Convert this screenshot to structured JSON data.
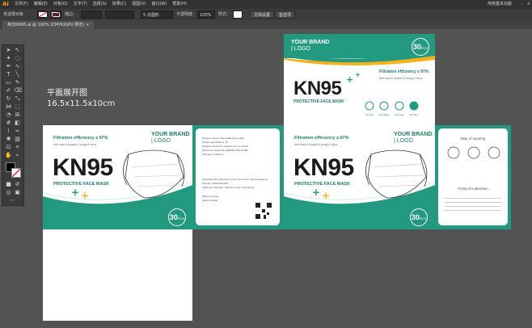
{
  "menubar": {
    "logo": "Ai",
    "items": [
      "文件(F)",
      "编辑(E)",
      "对象(O)",
      "文字(T)",
      "选择(S)",
      "效果(C)",
      "视图(V)",
      "窗口(W)",
      "帮助(H)"
    ],
    "workspace": "传统基本功能"
  },
  "controlbar": {
    "selection": "未选择对象",
    "stroke_label": "描边：",
    "brush": "5 点圆形",
    "opacity_label": "不透明度：",
    "opacity": "100%",
    "style_label": "样式：",
    "doc_setup": "文档设置",
    "preferences": "首选项"
  },
  "tab": {
    "title": "英文KN95.ai @ 100% (CMYK/GPU 预览)"
  },
  "canvas": {
    "title": "平面展开图",
    "size": "16.5x11.5x10cm"
  },
  "colors": {
    "teal": "#239a7f",
    "gold": "#f5b21b",
    "dark": "#1c1c1c"
  },
  "art": {
    "brand_line1": "YOUR BRAND",
    "brand_line2": "| LOGO",
    "kn95": "KN95",
    "protective": "PROTECTIVE FACE MASK",
    "filtration": "Filtration efficiency ≥ 97%",
    "anti_dust": "Anti  dust & droplet & smog & virus",
    "pcs_num": "30",
    "pcs_unit": "PCS",
    "icon_labels": [
      "Anti dust",
      "Anti droplet",
      "Anti smog",
      "Anti Virus"
    ],
    "info_lines": [
      "[Product name]: Disposable face mask",
      "[Model specification]: 10",
      "[Product standard]: medical use non-sterile",
      "[Execution standard]: GB2626-2006 KN95",
      "[Storage conditions]",
      "[Manufacturer]: Shenzhen Group Shenzhen City Guangdong",
      "[Phone]: 0755-0000-000",
      "[Address]: Nanshan, Shenzhen City Guangdong",
      "[Batch number]",
      "[Expiring date]"
    ],
    "way_of_wearing": "Way of wearing",
    "points_attention": "Points for attention"
  }
}
